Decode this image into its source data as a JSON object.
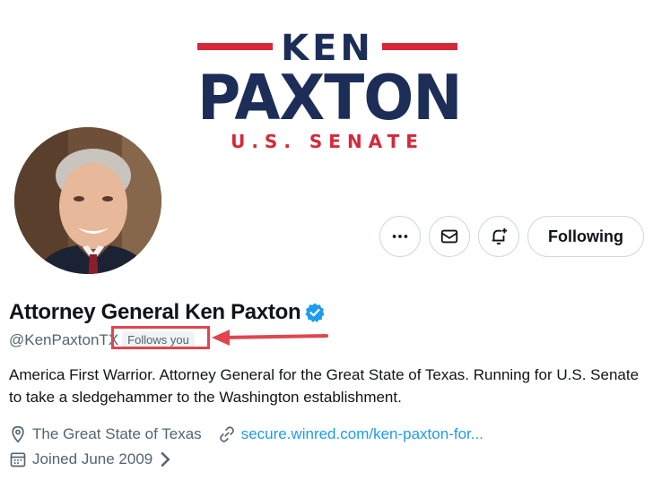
{
  "banner": {
    "logo_top": "KEN",
    "logo_main": "PAXTON",
    "logo_bottom": "U.S. SENATE",
    "colors": {
      "navy": "#1c2d58",
      "red": "#d6283a"
    }
  },
  "profile": {
    "avatar_icon": "profile-photo",
    "name": "Attorney General Ken Paxton",
    "handle": "@KenPaxtonTX",
    "follows_you": "Follows you",
    "verified_icon": "verified-badge-icon",
    "bio": "America First Warrior. Attorney General for the Great State of Texas. Running for U.S. Senate to take a sledgehammer to the Washington establishment.",
    "location": "The Great State of Texas",
    "website": "secure.winred.com/ken-paxton-for...",
    "joined": "Joined June 2009"
  },
  "actions": {
    "more_icon": "more-icon",
    "message_icon": "envelope-icon",
    "notify_icon": "bell-plus-icon",
    "follow_label": "Following"
  },
  "annotation": {
    "color": "#e0454f"
  }
}
